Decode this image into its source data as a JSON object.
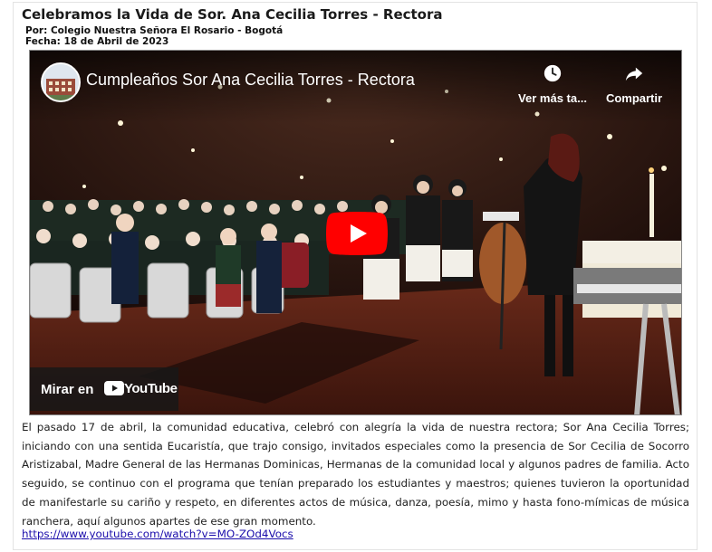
{
  "article": {
    "title": "Celebramos la Vida de Sor. Ana Cecilia Torres - Rectora",
    "author": "Por: Colegio Nuestra Señora El Rosario - Bogotá",
    "date": "Fecha: 18 de Abril de 2023",
    "body": "El pasado 17 de abril, la comunidad educativa, celebró con alegría la vida de nuestra rectora; Sor Ana Cecilia Torres; iniciando con una sentida Eucaristía, que trajo consigo, invitados especiales como la presencia de Sor Cecilia de Socorro Aristizabal, Madre General de las Hermanas Dominicas, Hermanas de la comunidad local y algunos padres de familia. Acto seguido, se continuo con el programa que tenían preparado los estudiantes y maestros; quienes tuvieron la oportunidad de manifestarle su cariño y respeto, en diferentes actos de música, danza, poesía, mimo y hasta fono-mímicas de música ranchera, aquí algunos apartes de ese gran momento.",
    "link_text": "https://www.youtube.com/watch?v=MO-ZOd4Vocs"
  },
  "video": {
    "title": "Cumpleaños Sor Ana Cecilia Torres - Rectora",
    "watch_later_label": "Ver más ta...",
    "share_label": "Compartir",
    "watch_on_label": "Mirar en",
    "youtube_brand": "YouTube",
    "icons": [
      "clock-icon",
      "share-arrow-icon",
      "play-icon",
      "youtube-logo-icon"
    ]
  },
  "colors": {
    "play_red": "#ff0000",
    "link_blue": "#1a0dab"
  }
}
